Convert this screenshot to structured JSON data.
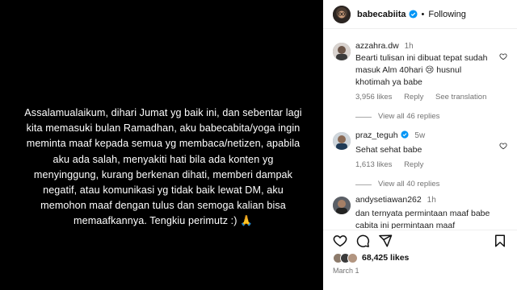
{
  "post": {
    "lines": [
      "Assalamualaikum, dihari Jumat yg baik ini, dan sebentar lagi",
      "kita memasuki bulan Ramadhan, aku babecabita/yoga ingin",
      "meminta maaf kepada semua yg membaca/netizen, apabila",
      "aku ada salah, menyakiti hati bila ada konten yg",
      "menyinggung, kurang berkenan dihati, memberi dampak",
      "negatif, atau komunikasi yg tidak baik lewat DM, aku",
      "memohon maaf dengan tulus dan semoga kalian bisa",
      "memaafkannya. Tengkiu perimutz :) 🙏"
    ]
  },
  "header": {
    "username": "babecabiita",
    "separator": "•",
    "follow_status": "Following"
  },
  "comments": [
    {
      "user": "azzahra.dw",
      "time": "1h",
      "text": "Bearti tulisan ini dibuat tepat sudah masuk Alm 40hari 😢 husnul khotimah ya babe",
      "likes": "3,956 likes",
      "reply": "Reply",
      "translation": "See translation",
      "view_replies": "View all 46 replies"
    },
    {
      "user": "praz_teguh",
      "time": "5w",
      "text": "Sehat sehat babe",
      "likes": "1,613 likes",
      "reply": "Reply",
      "view_replies": "View all 40 replies"
    },
    {
      "user": "andysetiawan262",
      "time": "1h",
      "text": "dan ternyata permintaan maaf babe cabita ini permintaan maaf"
    }
  ],
  "footer": {
    "likes": "68,425 likes",
    "date": "March 1"
  },
  "colors": {
    "background": "#000000",
    "panel": "#ffffff",
    "verified": "#0095f6",
    "muted": "#737373"
  }
}
